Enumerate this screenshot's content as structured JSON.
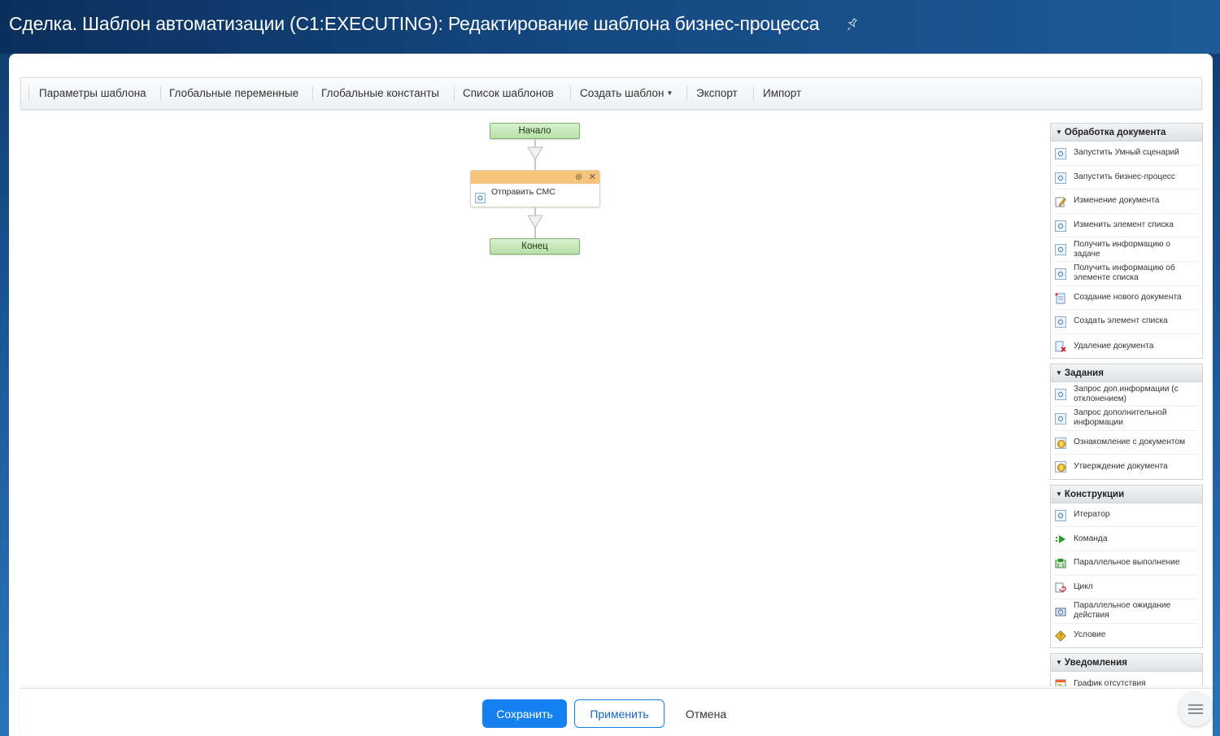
{
  "header": {
    "title": "Сделка. Шаблон автоматизации (C1:EXECUTING): Редактирование шаблона бизнес-процесса"
  },
  "toolbar": {
    "items": [
      {
        "label": "Параметры шаблона"
      },
      {
        "label": "Глобальные переменные"
      },
      {
        "label": "Глобальные константы"
      },
      {
        "label": "Список шаблонов"
      },
      {
        "label": "Создать шаблон"
      },
      {
        "label": "Экспорт"
      },
      {
        "label": "Импорт"
      }
    ]
  },
  "canvas": {
    "start_label": "Начало",
    "activity_label": "Отправить СМС",
    "end_label": "Конец"
  },
  "sidebar": {
    "groups": [
      {
        "title": "Обработка документа",
        "items": [
          {
            "label": "Запустить Умный сценарий",
            "icon": "activity-icon"
          },
          {
            "label": "Запустить бизнес-процесс",
            "icon": "activity-icon"
          },
          {
            "label": "Изменение документа",
            "icon": "edit-document-icon"
          },
          {
            "label": "Изменить элемент списка",
            "icon": "activity-icon"
          },
          {
            "label": "Получить информацию о задаче",
            "icon": "activity-icon"
          },
          {
            "label": "Получить информацию об элементе списка",
            "icon": "activity-icon"
          },
          {
            "label": "Создание нового документа",
            "icon": "new-document-icon"
          },
          {
            "label": "Создать элемент списка",
            "icon": "activity-icon"
          },
          {
            "label": "Удаление документа",
            "icon": "delete-document-icon"
          }
        ]
      },
      {
        "title": "Задания",
        "items": [
          {
            "label": "Запрос доп.информации (с отклонением)",
            "icon": "activity-icon"
          },
          {
            "label": "Запрос дополнительной информации",
            "icon": "activity-icon"
          },
          {
            "label": "Ознакомление с документом",
            "icon": "review-icon"
          },
          {
            "label": "Утверждение документа",
            "icon": "approval-icon"
          }
        ]
      },
      {
        "title": "Конструкции",
        "items": [
          {
            "label": "Итератор",
            "icon": "activity-icon"
          },
          {
            "label": "Команда",
            "icon": "command-icon"
          },
          {
            "label": "Параллельное выполнение",
            "icon": "parallel-icon"
          },
          {
            "label": "Цикл",
            "icon": "loop-icon"
          },
          {
            "label": "Параллельное ожидание действия",
            "icon": "parallel-wait-icon"
          },
          {
            "label": "Условие",
            "icon": "condition-icon"
          }
        ]
      },
      {
        "title": "Уведомления",
        "items": [
          {
            "label": "График отсутствия",
            "icon": "absence-chart-icon"
          }
        ]
      }
    ]
  },
  "footer": {
    "save_label": "Сохранить",
    "apply_label": "Применить",
    "cancel_label": "Отмена"
  },
  "colors": {
    "accent": "#1580f0",
    "activity_header": "#f6c57a",
    "terminal_fill": "#c8e8b9"
  }
}
